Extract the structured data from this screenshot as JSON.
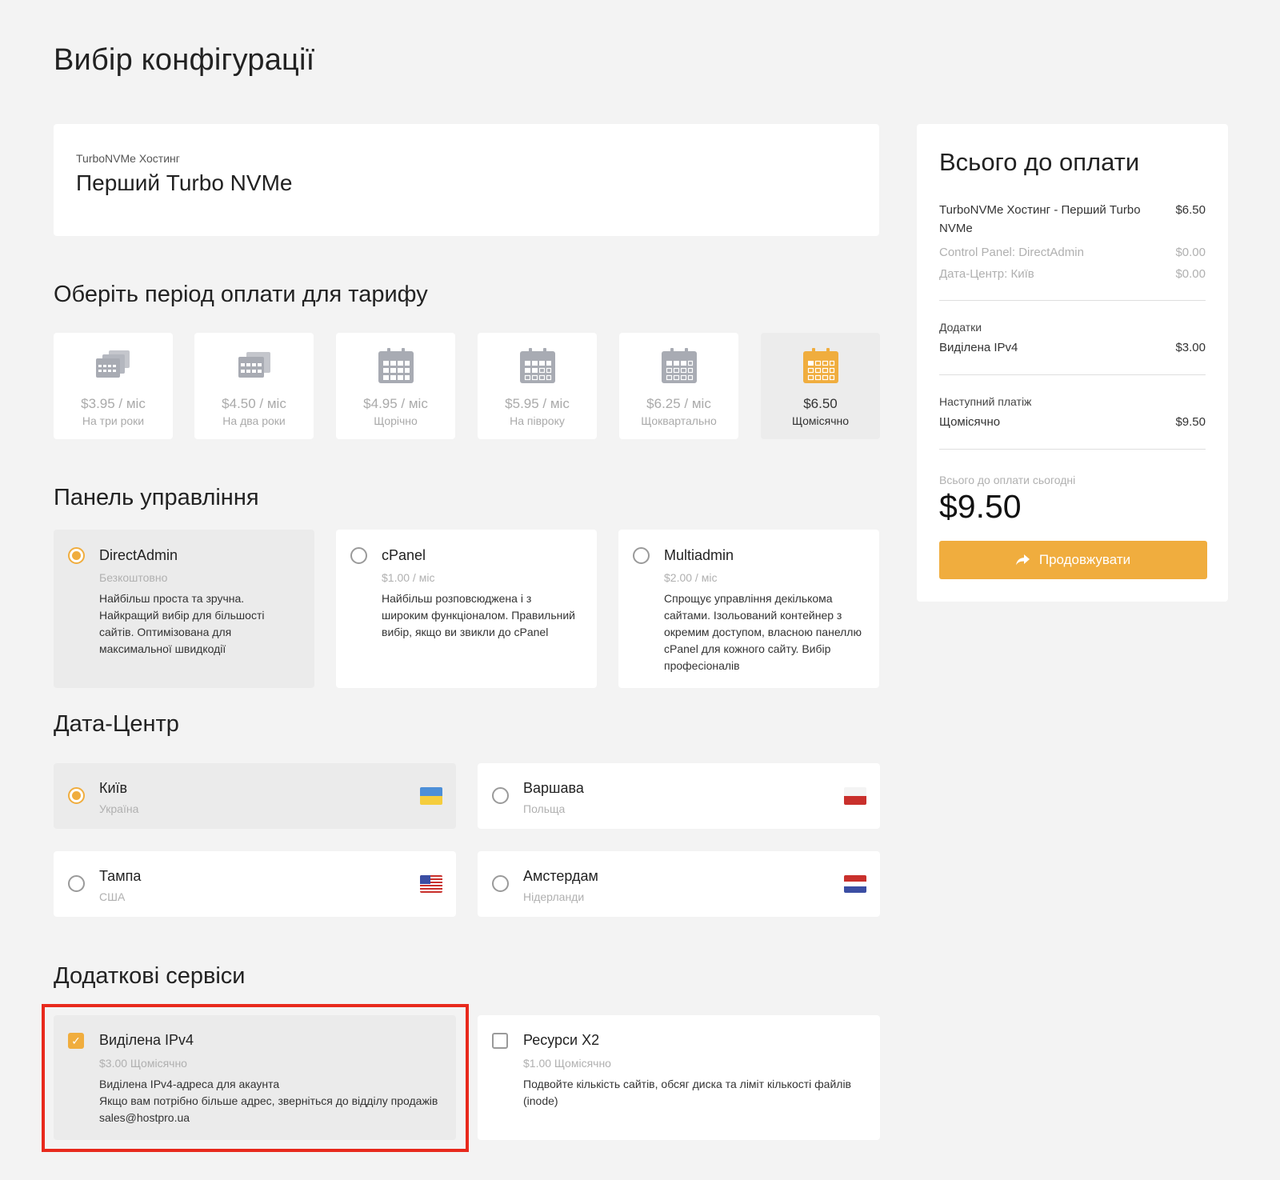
{
  "page": {
    "title": "Вибір конфігурації"
  },
  "product": {
    "category": "TurboNVMe Хостинг",
    "name": "Перший Turbo NVMe"
  },
  "billing": {
    "title": "Оберіть період оплати для тарифу",
    "periods": [
      {
        "price": "$3.95 / міс",
        "label": "На три роки",
        "selected": false,
        "icon": "calendar-stack-3-icon"
      },
      {
        "price": "$4.50 / міс",
        "label": "На два роки",
        "selected": false,
        "icon": "calendar-stack-2-icon"
      },
      {
        "price": "$4.95 / міс",
        "label": "Щорічно",
        "selected": false,
        "icon": "calendar-full-icon"
      },
      {
        "price": "$5.95 / міс",
        "label": "На півроку",
        "selected": false,
        "icon": "calendar-half-icon"
      },
      {
        "price": "$6.25 / міс",
        "label": "Щоквартально",
        "selected": false,
        "icon": "calendar-quarter-icon"
      },
      {
        "price": "$6.50",
        "label": "Щомісячно",
        "selected": true,
        "icon": "calendar-month-icon"
      }
    ]
  },
  "control_panel": {
    "title": "Панель управління",
    "options": [
      {
        "name": "DirectAdmin",
        "price": "Безкоштовно",
        "desc": "Найбільш проста та зручна. Найкращий вибір для більшості сайтів. Оптимізована для максимальної швидкодії",
        "selected": true
      },
      {
        "name": "cPanel",
        "price": "$1.00 / міс",
        "desc": "Найбільш розповсюджена і з широким функціоналом. Правильний вибір, якщо ви звикли до cPanel",
        "selected": false
      },
      {
        "name": "Multiadmin",
        "price": "$2.00 / міс",
        "desc": "Спрощує управління декількома сайтами. Ізольований контейнер з окремим доступом, власною панеллю cPanel для кожного сайту. Вибір професіоналів",
        "selected": false
      }
    ]
  },
  "datacenter": {
    "title": "Дата-Центр",
    "options": [
      {
        "city": "Київ",
        "country": "Україна",
        "flag": "ua-flag-icon",
        "selected": true
      },
      {
        "city": "Варшава",
        "country": "Польща",
        "flag": "pl-flag-icon",
        "selected": false
      },
      {
        "city": "Тампа",
        "country": "США",
        "flag": "us-flag-icon",
        "selected": false
      },
      {
        "city": "Амстердам",
        "country": "Нідерланди",
        "flag": "nl-flag-icon",
        "selected": false
      }
    ]
  },
  "addons": {
    "title": "Додаткові сервіси",
    "items": [
      {
        "name": "Виділена IPv4",
        "price": "$3.00 Щомісячно",
        "desc_line1": "Виділена IPv4-адреса для акаунта",
        "desc_line2": "Якщо вам потрібно більше адрес, зверніться до відділу продажів sales@hostpro.ua",
        "checked": true
      },
      {
        "name": "Ресурси X2",
        "price": "$1.00 Щомісячно",
        "desc_line1": "Подвойте кількість сайтів, обсяг диска та ліміт кількості файлів (inode)",
        "desc_line2": "",
        "checked": false
      }
    ]
  },
  "summary": {
    "title": "Всього до оплати",
    "product_line": {
      "label": "TurboNVMe Хостинг - Перший Turbo NVMe",
      "value": "$6.50"
    },
    "panel_line": {
      "label": "Control Panel: DirectAdmin",
      "value": "$0.00"
    },
    "dc_line": {
      "label": "Дата-Центр: Київ",
      "value": "$0.00"
    },
    "addons_heading": "Додатки",
    "addon_line": {
      "label": "Виділена IPv4",
      "value": "$3.00"
    },
    "next_payment_heading": "Наступний платіж",
    "next_line": {
      "label": "Щомісячно",
      "value": "$9.50"
    },
    "total_today_label": "Всього до оплати сьогодні",
    "total_today_value": "$9.50",
    "continue_label": "Продовжувати"
  },
  "colors": {
    "accent": "#f0ad3e",
    "highlight": "#e8291c",
    "background": "#f3f3f3"
  }
}
